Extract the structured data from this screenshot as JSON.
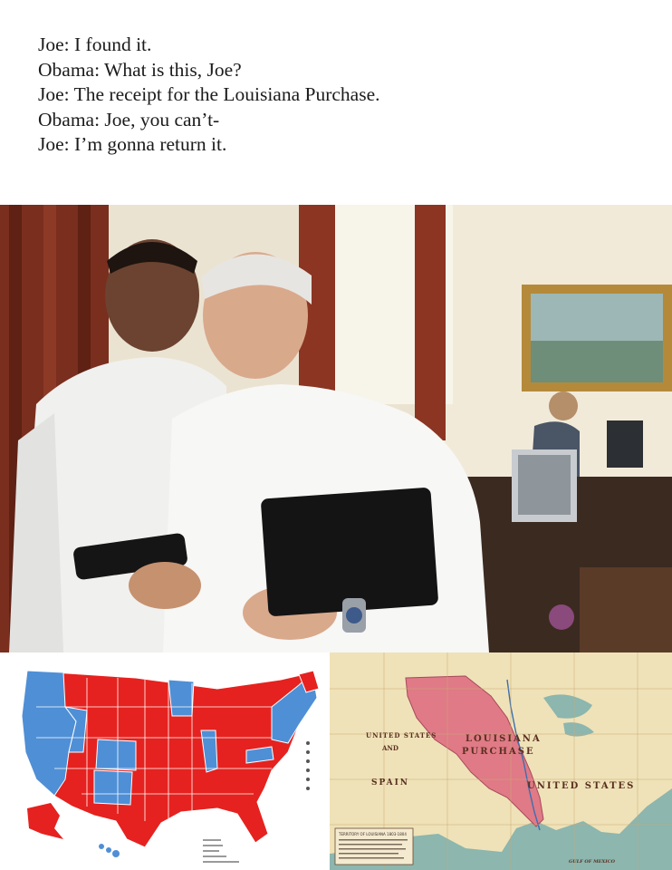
{
  "caption": {
    "lines": [
      "Joe: I found it.",
      "Obama: What is this, Joe?",
      "Joe: The receipt for the Louisiana Purchase.",
      "Obama: Joe, you can’t-",
      "Joe: I’m gonna return it."
    ]
  },
  "photo": {
    "subject": "two men looking at a phone in an office",
    "colors": {
      "curtain": "#7a2e1e",
      "wall": "#efe8d8",
      "shirt": "#f3f3f3",
      "folder": "#141414"
    }
  },
  "election_map": {
    "colors": {
      "red": "#e5221f",
      "blue": "#4f8fd6",
      "border": "#ffffff"
    }
  },
  "historical_map": {
    "labels": {
      "louisiana": "LOUISIANA",
      "purchase": "PURCHASE",
      "united_states": "UNITED STATES",
      "and": "AND",
      "spain": "SPAIN",
      "united_states_right": "UNITED STATES",
      "gulf": "GULF OF MEXICO",
      "legend_title": "TERRITORY OF LOUISIANA 1803-1804"
    },
    "colors": {
      "land": "#efe2b8",
      "purchase": "#e07a86",
      "water": "#8cb6ae",
      "river": "#3a6fb0"
    }
  }
}
